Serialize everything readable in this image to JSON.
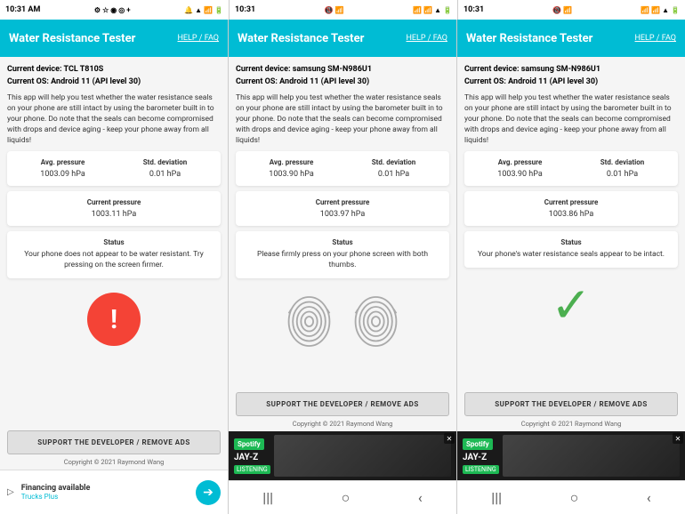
{
  "panels": [
    {
      "id": "panel-1",
      "statusBar": {
        "time": "10:31 AM",
        "leftIcons": "⚙ ☆ ◎ ◎ +",
        "rightIcons": "🔊 📶 🔋"
      },
      "header": {
        "title": "Water Resistance Tester",
        "helpLabel": "HELP / FAQ"
      },
      "device": "Current device: TCL T810S",
      "os": "Current OS: Android 11 (API level 30)",
      "description": "This app will help you test whether the water resistance seals on your phone are still intact by using the barometer built in to your phone. Do note that the seals can become compromised with drops and device aging - keep your phone away from all liquids!",
      "avgPressure": {
        "label": "Avg. pressure",
        "value": "1003.09 hPa"
      },
      "stdDev": {
        "label": "Std. deviation",
        "value": "0.01 hPa"
      },
      "currentPressure": {
        "label": "Current pressure",
        "value": "1003.11 hPa"
      },
      "statusLabel": "Status",
      "statusText": "Your phone does not appear to be water resistant. Try pressing on the screen firmer.",
      "warningType": "exclamation",
      "supportBtn": "SUPPORT THE DEVELOPER / REMOVE ADS",
      "copyright": "Copyright © 2021 Raymond Wang",
      "bottomType": "financing",
      "financing": {
        "title": "Financing available",
        "sub": "Trucks Plus"
      }
    },
    {
      "id": "panel-2",
      "statusBar": {
        "time": "10:31",
        "leftIcons": "📶 📶",
        "rightIcons": "📶 🔋"
      },
      "header": {
        "title": "Water Resistance Tester",
        "helpLabel": "HELP / FAQ"
      },
      "device": "Current device: samsung SM-N986U1",
      "os": "Current OS: Android 11 (API level 30)",
      "description": "This app will help you test whether the water resistance seals on your phone are still intact by using the barometer built in to your phone. Do note that the seals can become compromised with drops and device aging - keep your phone away from all liquids!",
      "avgPressure": {
        "label": "Avg. pressure",
        "value": "1003.90 hPa"
      },
      "stdDev": {
        "label": "Std. deviation",
        "value": "0.01 hPa"
      },
      "currentPressure": {
        "label": "Current pressure",
        "value": "1003.97 hPa"
      },
      "statusLabel": "Status",
      "statusText": "Please firmly press on your phone screen with both thumbs.",
      "warningType": "fingerprints",
      "supportBtn": "SUPPORT THE DEVELOPER / REMOVE ADS",
      "copyright": "Copyright © 2021 Raymond Wang",
      "bottomType": "ad"
    },
    {
      "id": "panel-3",
      "statusBar": {
        "time": "10:31",
        "leftIcons": "📶 📶",
        "rightIcons": "📶 🔋"
      },
      "header": {
        "title": "Water Resistance Tester",
        "helpLabel": "HELP / FAQ"
      },
      "device": "Current device: samsung SM-N986U1",
      "os": "Current OS: Android 11 (API level 30)",
      "description": "This app will help you test whether the water resistance seals on your phone are still intact by using the barometer built in to your phone. Do note that the seals can become compromised with drops and device aging - keep your phone away from all liquids!",
      "avgPressure": {
        "label": "Avg. pressure",
        "value": "1003.90 hPa"
      },
      "stdDev": {
        "label": "Std. deviation",
        "value": "0.01 hPa"
      },
      "currentPressure": {
        "label": "Current pressure",
        "value": "1003.86 hPa"
      },
      "statusLabel": "Status",
      "statusText": "Your phone's water resistance seals appear to be intact.",
      "warningType": "checkmark",
      "supportBtn": "SUPPORT THE DEVELOPER / REMOVE ADS",
      "copyright": "Copyright © 2021 Raymond Wang",
      "bottomType": "ad"
    }
  ],
  "nav": {
    "items": [
      "|||",
      "○",
      "<"
    ]
  }
}
